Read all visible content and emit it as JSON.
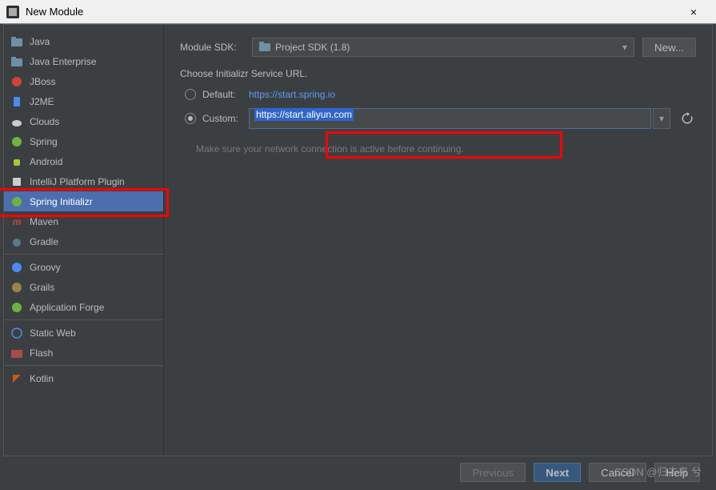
{
  "titlebar": {
    "title": "New Module",
    "close_icon": "×"
  },
  "sidebar": {
    "items": [
      {
        "label": "Java",
        "icon_color": "#6e8fa6"
      },
      {
        "label": "Java Enterprise",
        "icon_color": "#6e8fa6"
      },
      {
        "label": "JBoss",
        "icon_color": "#d04437"
      },
      {
        "label": "J2ME",
        "icon_color": "#4a8af4"
      },
      {
        "label": "Clouds",
        "icon_color": "#cccccc"
      },
      {
        "label": "Spring",
        "icon_color": "#6db33f"
      },
      {
        "label": "Android",
        "icon_color": "#a4c639"
      },
      {
        "label": "IntelliJ Platform Plugin",
        "icon_color": "#cccccc"
      },
      {
        "label": "Spring Initializr",
        "icon_color": "#6db33f",
        "selected": true
      },
      {
        "label": "Maven",
        "icon_color": "#c7453f"
      },
      {
        "label": "Gradle",
        "icon_color": "#5b7a8c"
      },
      {
        "label": "Groovy",
        "icon_color": "#4a8af4"
      },
      {
        "label": "Grails",
        "icon_color": "#9b8249"
      },
      {
        "label": "Application Forge",
        "icon_color": "#6db33f"
      },
      {
        "label": "Static Web",
        "icon_color": "#4a8af4"
      },
      {
        "label": "Flash",
        "icon_color": "#a84b4b"
      },
      {
        "label": "Kotlin",
        "icon_color": "#c75c16"
      }
    ]
  },
  "content": {
    "sdk_label": "Module SDK:",
    "sdk_value": "Project SDK (1.8)",
    "new_button": "New...",
    "section_label": "Choose Initializr Service URL.",
    "default_label": "Default:",
    "default_url": "https://start.spring.io",
    "custom_label": "Custom:",
    "custom_url": "https://start.aliyun.com",
    "hint": "Make sure your network connection is active before continuing.",
    "history_icon": "▾",
    "refresh_icon": "⟳"
  },
  "buttons": {
    "previous": "Previous",
    "next": "Next",
    "cancel": "Cancel",
    "help": "Help"
  },
  "watermark": "CSDN @归去来 兮"
}
